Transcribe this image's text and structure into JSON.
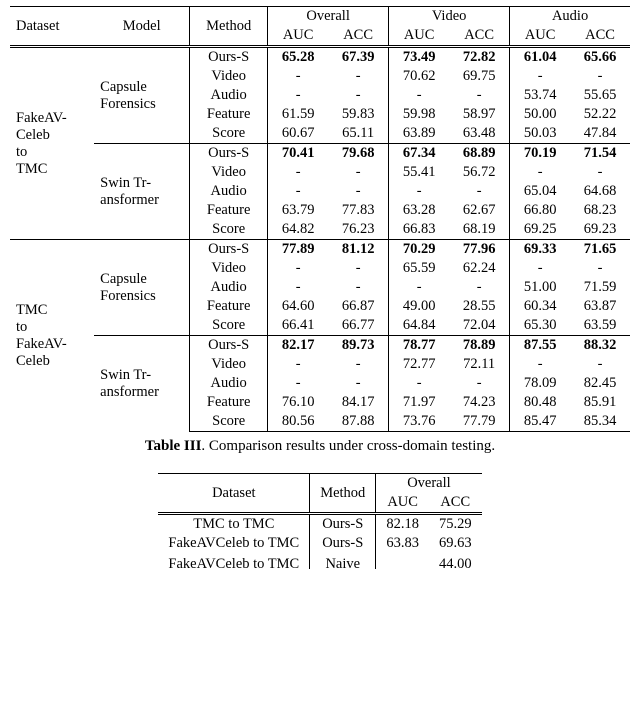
{
  "table1": {
    "header": {
      "dataset": "Dataset",
      "model": "Model",
      "method": "Method",
      "overall": "Overall",
      "video": "Video",
      "audio": "Audio",
      "auc": "AUC",
      "acc": "ACC"
    },
    "groups": [
      {
        "dataset_lines": [
          "FakeAV-",
          "Celeb",
          "to",
          "TMC"
        ],
        "models": [
          {
            "name_lines": [
              "Capsule",
              "Forensics"
            ],
            "rows": [
              {
                "method": "Ours-S",
                "overall_auc": "65.28",
                "overall_acc": "67.39",
                "video_auc": "73.49",
                "video_acc": "72.82",
                "audio_auc": "61.04",
                "audio_acc": "65.66",
                "bold": [
                  "overall_auc",
                  "overall_acc",
                  "video_auc",
                  "video_acc",
                  "audio_auc",
                  "audio_acc"
                ]
              },
              {
                "method": "Video",
                "overall_auc": "-",
                "overall_acc": "-",
                "video_auc": "70.62",
                "video_acc": "69.75",
                "audio_auc": "-",
                "audio_acc": "-"
              },
              {
                "method": "Audio",
                "overall_auc": "-",
                "overall_acc": "-",
                "video_auc": "-",
                "video_acc": "-",
                "audio_auc": "53.74",
                "audio_acc": "55.65"
              },
              {
                "method": "Feature",
                "overall_auc": "61.59",
                "overall_acc": "59.83",
                "video_auc": "59.98",
                "video_acc": "58.97",
                "audio_auc": "50.00",
                "audio_acc": "52.22"
              },
              {
                "method": "Score",
                "overall_auc": "60.67",
                "overall_acc": "65.11",
                "video_auc": "63.89",
                "video_acc": "63.48",
                "audio_auc": "50.03",
                "audio_acc": "47.84"
              }
            ]
          },
          {
            "name_lines": [
              "Swin Tr-",
              "ansformer"
            ],
            "rows": [
              {
                "method": "Ours-S",
                "overall_auc": "70.41",
                "overall_acc": "79.68",
                "video_auc": "67.34",
                "video_acc": "68.89",
                "audio_auc": "70.19",
                "audio_acc": "71.54",
                "bold": [
                  "overall_auc",
                  "overall_acc",
                  "video_auc",
                  "video_acc",
                  "audio_auc",
                  "audio_acc"
                ]
              },
              {
                "method": "Video",
                "overall_auc": "-",
                "overall_acc": "-",
                "video_auc": "55.41",
                "video_acc": "56.72",
                "audio_auc": "-",
                "audio_acc": "-"
              },
              {
                "method": "Audio",
                "overall_auc": "-",
                "overall_acc": "-",
                "video_auc": "-",
                "video_acc": "-",
                "audio_auc": "65.04",
                "audio_acc": "64.68"
              },
              {
                "method": "Feature",
                "overall_auc": "63.79",
                "overall_acc": "77.83",
                "video_auc": "63.28",
                "video_acc": "62.67",
                "audio_auc": "66.80",
                "audio_acc": "68.23"
              },
              {
                "method": "Score",
                "overall_auc": "64.82",
                "overall_acc": "76.23",
                "video_auc": "66.83",
                "video_acc": "68.19",
                "audio_auc": "69.25",
                "audio_acc": "69.23"
              }
            ]
          }
        ]
      },
      {
        "dataset_lines": [
          "TMC",
          "to",
          "FakeAV-",
          "Celeb"
        ],
        "models": [
          {
            "name_lines": [
              "Capsule",
              "Forensics"
            ],
            "rows": [
              {
                "method": "Ours-S",
                "overall_auc": "77.89",
                "overall_acc": "81.12",
                "video_auc": "70.29",
                "video_acc": "77.96",
                "audio_auc": "69.33",
                "audio_acc": "71.65",
                "bold": [
                  "overall_auc",
                  "overall_acc",
                  "video_auc",
                  "video_acc",
                  "audio_auc",
                  "audio_acc"
                ]
              },
              {
                "method": "Video",
                "overall_auc": "-",
                "overall_acc": "-",
                "video_auc": "65.59",
                "video_acc": "62.24",
                "audio_auc": "-",
                "audio_acc": "-"
              },
              {
                "method": "Audio",
                "overall_auc": "-",
                "overall_acc": "-",
                "video_auc": "-",
                "video_acc": "-",
                "audio_auc": "51.00",
                "audio_acc": "71.59"
              },
              {
                "method": "Feature",
                "overall_auc": "64.60",
                "overall_acc": "66.87",
                "video_auc": "49.00",
                "video_acc": "28.55",
                "audio_auc": "60.34",
                "audio_acc": "63.87"
              },
              {
                "method": "Score",
                "overall_auc": "66.41",
                "overall_acc": "66.77",
                "video_auc": "64.84",
                "video_acc": "72.04",
                "audio_auc": "65.30",
                "audio_acc": "63.59"
              }
            ]
          },
          {
            "name_lines": [
              "Swin Tr-",
              "ansformer"
            ],
            "rows": [
              {
                "method": "Ours-S",
                "overall_auc": "82.17",
                "overall_acc": "89.73",
                "video_auc": "78.77",
                "video_acc": "78.89",
                "audio_auc": "87.55",
                "audio_acc": "88.32",
                "bold": [
                  "overall_auc",
                  "overall_acc",
                  "video_auc",
                  "video_acc",
                  "audio_auc",
                  "audio_acc"
                ]
              },
              {
                "method": "Video",
                "overall_auc": "-",
                "overall_acc": "-",
                "video_auc": "72.77",
                "video_acc": "72.11",
                "audio_auc": "-",
                "audio_acc": "-"
              },
              {
                "method": "Audio",
                "overall_auc": "-",
                "overall_acc": "-",
                "video_auc": "-",
                "video_acc": "-",
                "audio_auc": "78.09",
                "audio_acc": "82.45"
              },
              {
                "method": "Feature",
                "overall_auc": "76.10",
                "overall_acc": "84.17",
                "video_auc": "71.97",
                "video_acc": "74.23",
                "audio_auc": "80.48",
                "audio_acc": "85.91"
              },
              {
                "method": "Score",
                "overall_auc": "80.56",
                "overall_acc": "87.88",
                "video_auc": "73.76",
                "video_acc": "77.79",
                "audio_auc": "85.47",
                "audio_acc": "85.34"
              }
            ]
          }
        ]
      }
    ],
    "caption_prefix": "Table III",
    "caption_rest": ". Comparison results under cross-domain testing."
  },
  "table2": {
    "header": {
      "dataset": "Dataset",
      "method": "Method",
      "overall": "Overall",
      "auc": "AUC",
      "acc": "ACC"
    },
    "rows": [
      {
        "dataset": "TMC to TMC",
        "method": "Ours-S",
        "auc": "82.18",
        "acc": "75.29"
      },
      {
        "dataset": "FakeAVCeleb to TMC",
        "method": "Ours-S",
        "auc": "63.83",
        "acc": "69.63"
      },
      {
        "dataset": "FakeAVCeleb to TMC",
        "method": "Naive",
        "auc": "",
        "acc": "44.00"
      }
    ]
  }
}
